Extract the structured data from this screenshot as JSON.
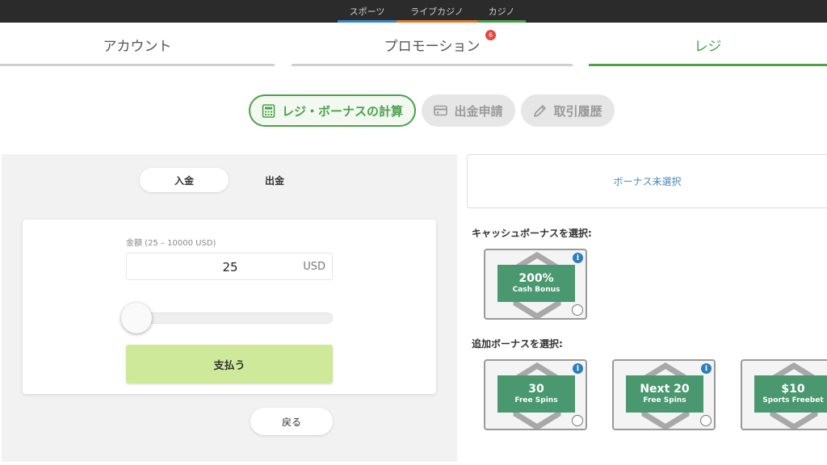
{
  "top_nav": [
    {
      "label": "スポーツ",
      "color": "#3a86d0"
    },
    {
      "label": "ライブカジノ",
      "color": "#e07a2e"
    },
    {
      "label": "カジノ",
      "color": "#4aa24a"
    }
  ],
  "main_tabs": [
    {
      "label": "アカウント",
      "active": false
    },
    {
      "label": "プロモーション",
      "active": false,
      "badge": "6"
    },
    {
      "label": "レジ",
      "active": true
    }
  ],
  "sub_tabs": {
    "calc": "レジ・ボーナスの計算",
    "withdraw": "出金申請",
    "history": "取引履歴"
  },
  "deposit_form": {
    "tab_deposit": "入金",
    "tab_withdraw": "出金",
    "amount_label": "金額 (25 – 10000 USD)",
    "amount_value": "25",
    "currency": "USD",
    "slider_level": 0,
    "pay_label": "支払う",
    "back_label": "戻る"
  },
  "bonus": {
    "no_bonus": "ボーナス未選択",
    "cash_label": "キャッシュボーナスを選択:",
    "extra_label": "追加ボーナスを選択:",
    "cash_bonuses": [
      {
        "main": "200%",
        "sub": "Cash Bonus"
      }
    ],
    "extra_bonuses": [
      {
        "main": "30",
        "sub": "Free Spins"
      },
      {
        "main": "Next 20",
        "sub": "Free Spins"
      },
      {
        "main": "$10",
        "sub": "Sports Freebet"
      }
    ],
    "info_glyph": "i"
  },
  "colors": {
    "accent": "#4aa24a",
    "pay_button": "#cfe99a",
    "bonus_banner": "#4a9870",
    "info": "#2a7fbf",
    "badge": "#e8453c"
  }
}
